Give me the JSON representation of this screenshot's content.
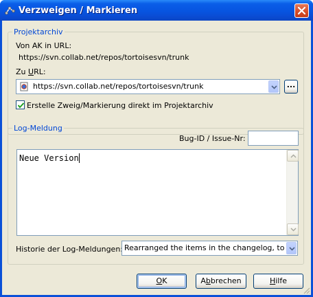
{
  "window": {
    "title": "Verzweigen / Markieren",
    "title_icon": "branch-tag-icon",
    "close_icon": "close-icon",
    "colors": {
      "titlebar": "#0754e0",
      "client": "#ece9d8",
      "group_title": "#0046d5",
      "close": "#d54a25"
    }
  },
  "repository": {
    "group_title": "Projektarchiv",
    "from_label": "Von AK in URL:",
    "from_url": "https://svn.collab.net/repos/tortoisesvn/trunk",
    "to_label_pre": "Zu ",
    "to_label_accel": "U",
    "to_label_post": "RL:",
    "to_url": "https://svn.collab.net/repos/tortoisesvn/trunk",
    "to_url_icon": "url-file-icon",
    "browse_label": "...",
    "checkbox_checked": true,
    "checkbox_label": "Erstelle Zweig/Markierung direkt im Projektarchiv"
  },
  "log": {
    "group_title": "Log-Meldung",
    "bugid_label": "Bug-ID / Issue-Nr:",
    "bugid_value": "",
    "message": "Neue Version",
    "history_label": "Historie der Log-Meldungen:",
    "history_selected": "Rearranged the items in the changelog, to sort it"
  },
  "buttons": {
    "ok_accel": "O",
    "ok_rest": "K",
    "cancel_pre": "A",
    "cancel_accel": "b",
    "cancel_post": "brechen",
    "help_accel": "H",
    "help_rest": "ilfe"
  }
}
